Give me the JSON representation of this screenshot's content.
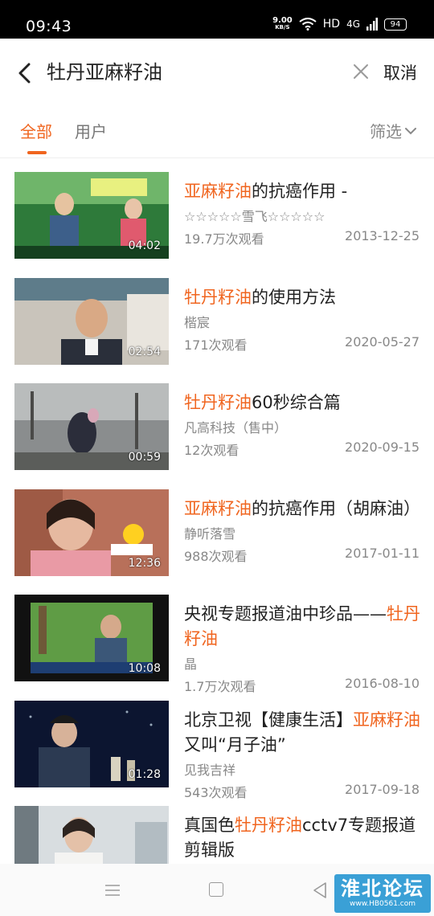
{
  "status_bar": {
    "time": "09:43",
    "net_speed": "9.00",
    "net_speed_unit": "KB/S",
    "hd": "HD",
    "signal": "4G",
    "battery": "94"
  },
  "search": {
    "query": "牡丹亚麻籽油",
    "cancel_label": "取消"
  },
  "tabs": {
    "all": "全部",
    "users": "用户",
    "filter": "筛选"
  },
  "results": [
    {
      "title_parts": [
        {
          "text": "亚麻籽油",
          "hl": true
        },
        {
          "text": "的抗癌作用 -",
          "hl": false
        }
      ],
      "author": "☆☆☆☆☆雪飞☆☆☆☆☆",
      "views": "19.7万次观看",
      "date": "2013-12-25",
      "duration": "04:02",
      "thumb_theme": "green-studio"
    },
    {
      "title_parts": [
        {
          "text": "牡丹籽油",
          "hl": true
        },
        {
          "text": "的使用方法",
          "hl": false
        }
      ],
      "author": "楷宸",
      "views": "171次观看",
      "date": "2020-05-27",
      "duration": "02:54",
      "thumb_theme": "man-office"
    },
    {
      "title_parts": [
        {
          "text": "牡丹籽油",
          "hl": true
        },
        {
          "text": "60秒综合篇",
          "hl": false
        }
      ],
      "author": "凡高科技（售中）",
      "views": "12次观看",
      "date": "2020-09-15",
      "duration": "00:59",
      "thumb_theme": "outdoor-grey"
    },
    {
      "title_parts": [
        {
          "text": "亚麻籽油",
          "hl": true
        },
        {
          "text": "的抗癌作用（胡麻油）",
          "hl": false
        }
      ],
      "author": "静听落雪",
      "views": "988次观看",
      "date": "2017-01-11",
      "duration": "12:36",
      "thumb_theme": "woman-pink"
    },
    {
      "title_parts": [
        {
          "text": "央视专题报道油中珍品——",
          "hl": false
        },
        {
          "text": "牡丹籽油",
          "hl": true
        }
      ],
      "author": "晶",
      "views": "1.7万次观看",
      "date": "2016-08-10",
      "duration": "10:08",
      "thumb_theme": "tv-interview"
    },
    {
      "title_parts": [
        {
          "text": "北京卫视【健康生活】",
          "hl": false
        },
        {
          "text": "亚麻籽油",
          "hl": true
        },
        {
          "text": "又叫“月子油”",
          "hl": false
        }
      ],
      "author": "见我吉祥",
      "views": "543次观看",
      "date": "2017-09-18",
      "duration": "01:28",
      "thumb_theme": "officer-dark"
    },
    {
      "title_parts": [
        {
          "text": "真国色",
          "hl": false
        },
        {
          "text": "牡丹籽油",
          "hl": true
        },
        {
          "text": "cctv7专题报道剪辑版",
          "hl": false
        }
      ],
      "author": "",
      "views": "",
      "date": "",
      "duration": "",
      "thumb_theme": "woman-lab"
    }
  ],
  "watermark": {
    "main": "淮北论坛",
    "sub": "www.HB0561.com"
  },
  "colors": {
    "accent": "#f0651f",
    "text_primary": "#222222",
    "text_secondary": "#888888"
  }
}
